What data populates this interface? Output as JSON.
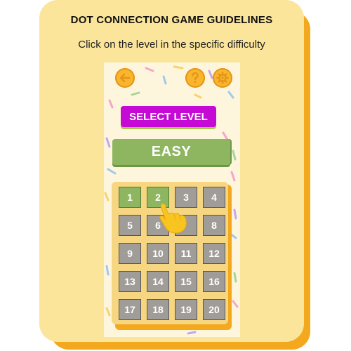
{
  "header": {
    "title": "DOT CONNECTION GAME GUIDELINES",
    "instruction": "Click on the level in the specific difficulty"
  },
  "game": {
    "top_buttons": [
      {
        "name": "back",
        "icon": "arrow-left-icon"
      },
      {
        "name": "help",
        "icon": "question-mark-icon"
      },
      {
        "name": "settings",
        "icon": "gear-icon"
      }
    ],
    "select_level_label": "SELECT LEVEL",
    "difficulty_label": "EASY",
    "levels": [
      {
        "label": "1",
        "completed": true
      },
      {
        "label": "2",
        "completed": true
      },
      {
        "label": "3",
        "completed": false
      },
      {
        "label": "4",
        "completed": false
      },
      {
        "label": "5",
        "completed": false
      },
      {
        "label": "6",
        "completed": false
      },
      {
        "label": "",
        "completed": false
      },
      {
        "label": "8",
        "completed": false
      },
      {
        "label": "9",
        "completed": false
      },
      {
        "label": "10",
        "completed": false
      },
      {
        "label": "11",
        "completed": false
      },
      {
        "label": "12",
        "completed": false
      },
      {
        "label": "13",
        "completed": false
      },
      {
        "label": "14",
        "completed": false
      },
      {
        "label": "15",
        "completed": false
      },
      {
        "label": "16",
        "completed": false
      },
      {
        "label": "17",
        "completed": false
      },
      {
        "label": "18",
        "completed": false
      },
      {
        "label": "19",
        "completed": false
      },
      {
        "label": "20",
        "completed": false
      }
    ],
    "pointer_icon": "pointing-hand-icon"
  },
  "colors": {
    "card": "#fbe59a",
    "card_shadow": "#f4a81d",
    "select_level_bg": "#c50ad6",
    "easy_bg": "#8eb660",
    "level_tile": "#a09c98",
    "level_done": "#8eb660",
    "board": "#f7d681",
    "button": "#f9b52b"
  }
}
